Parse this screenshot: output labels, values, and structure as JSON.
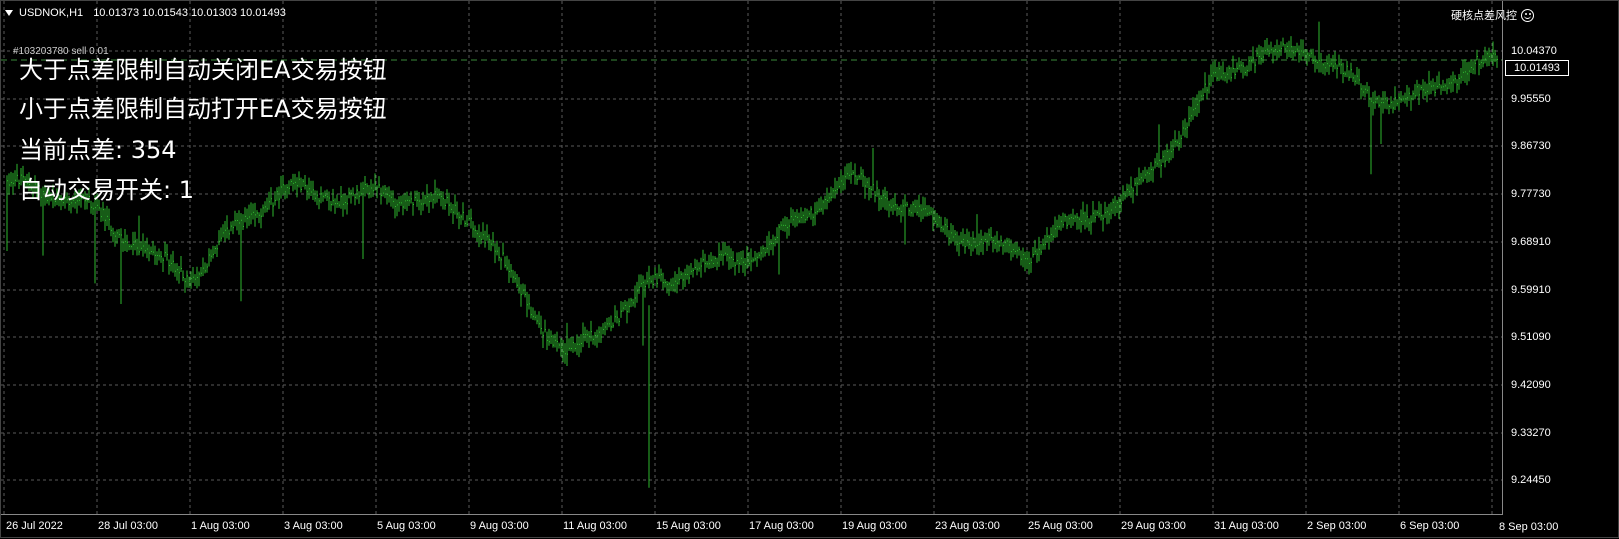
{
  "header": {
    "symbol": "USDNOK,H1",
    "ohlc": "10.01373 10.01543 10.01303 10.01493"
  },
  "top_right": {
    "label": "硬核点差风控",
    "icon": "smiley-icon"
  },
  "order_line": {
    "label": "#103203780 sell 0.01"
  },
  "overlay": {
    "line1": "大于点差限制自动关闭EA交易按钮",
    "line2": "小于点差限制自动打开EA交易按钮",
    "line3": "当前点差: 354",
    "line4": "自动交易开关: 1"
  },
  "price_axis": {
    "labels": [
      "10.04370",
      "9.95550",
      "9.86730",
      "9.77730",
      "9.68910",
      "9.59910",
      "9.51090",
      "9.42090",
      "9.33270",
      "9.24450"
    ],
    "current_price": "10.01493"
  },
  "time_axis": {
    "labels": [
      "26 Jul 2022",
      "28 Jul 03:00",
      "1 Aug 03:00",
      "3 Aug 03:00",
      "5 Aug 03:00",
      "9 Aug 03:00",
      "11 Aug 03:00",
      "15 Aug 03:00",
      "17 Aug 03:00",
      "19 Aug 03:00",
      "23 Aug 03:00",
      "25 Aug 03:00",
      "29 Aug 03:00",
      "31 Aug 03:00",
      "2 Sep 03:00",
      "6 Sep 03:00"
    ],
    "last_label": "8 Sep 03:00"
  },
  "colors": {
    "background": "#000000",
    "bars": "#2eb82e",
    "grid": "#5a5a5a",
    "text": "#ffffff"
  },
  "chart_data": {
    "type": "line",
    "y_unit": "price",
    "ylim": [
      9.2,
      10.08
    ],
    "x": [
      "26 Jul 2022",
      "28 Jul 03:00",
      "1 Aug 03:00",
      "3 Aug 03:00",
      "5 Aug 03:00",
      "9 Aug 03:00",
      "11 Aug 03:00",
      "15 Aug 03:00",
      "17 Aug 03:00",
      "19 Aug 03:00",
      "23 Aug 03:00",
      "25 Aug 03:00",
      "29 Aug 03:00",
      "31 Aug 03:00",
      "2 Sep 03:00",
      "6 Sep 03:00",
      "8 Sep 03:00"
    ],
    "series": [
      {
        "values": [
          9.79,
          9.74,
          9.63,
          9.78,
          9.79,
          9.72,
          9.49,
          9.6,
          9.68,
          9.79,
          9.73,
          9.66,
          9.77,
          10.0,
          10.04,
          9.95,
          10.015
        ]
      }
    ]
  }
}
